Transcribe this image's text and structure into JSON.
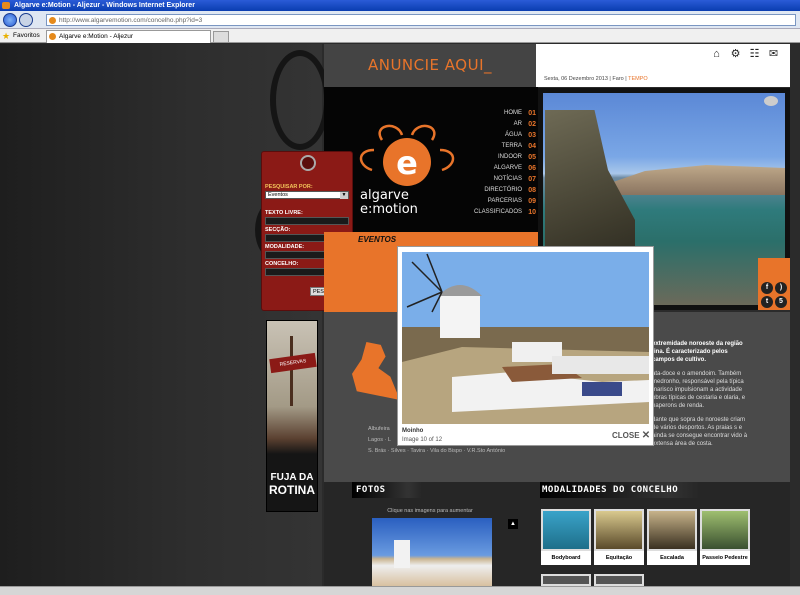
{
  "browser": {
    "title": "Algarve e:Motion - Aljezur - Windows Internet Explorer",
    "url": "http://www.algarvemotion.com/concelho.php?id=3",
    "favorites_label": "Favoritos",
    "tab_title": "Algarve e:Motion - Aljezur"
  },
  "ad": {
    "text": "ANUNCIE AQUI_"
  },
  "header": {
    "date": "Sexta, 06 Dezembro 2013",
    "location": "Faro",
    "weather_link": "TEMPO"
  },
  "logo": {
    "line1": "algarve",
    "line2": "e:motion"
  },
  "menu": [
    {
      "label": "HOME",
      "num": "01"
    },
    {
      "label": "AR",
      "num": "02"
    },
    {
      "label": "ÁGUA",
      "num": "03"
    },
    {
      "label": "TERRA",
      "num": "04"
    },
    {
      "label": "INDOOR",
      "num": "05"
    },
    {
      "label": "ALGARVE",
      "num": "06"
    },
    {
      "label": "NOTÍCIAS",
      "num": "07"
    },
    {
      "label": "DIRECTÓRIO",
      "num": "08"
    },
    {
      "label": "PARCERIAS",
      "num": "09"
    },
    {
      "label": "CLASSIFICADOS",
      "num": "10"
    }
  ],
  "search": {
    "heading": "PESQUISAR POR:",
    "type_value": "Eventos",
    "free_text_label": "TEXTO LIVRE:",
    "section_label": "SECÇÃO:",
    "modality_label": "MODALIDADE:",
    "council_label": "CONCELHO:",
    "button": "PESQUISAR"
  },
  "events_label": "EVENTOS",
  "banner": {
    "sign": "RESERVAS",
    "line1": "FUJA DA",
    "line2": "ROTINA"
  },
  "places": {
    "line1": "Albufeira",
    "line2": "Lagos · L",
    "line3": "S. Brás · Silves · Tavira · Vila do Bispo · V.R.Sto António"
  },
  "intro": {
    "p1": "extremidade noroeste da região",
    "p1b": "tina. É caracterizado pelos",
    "p1c": "campos de cultivo.",
    "p2": "ata-doce e o amendoim. Também medronho, responsável pela típica marisco impulsionam a actividade obras típicas de cestaria e olaria, e naperons de renda.",
    "p3": "dante que sopra de noroeste criam de vários desportos. As praias s e ainda se consegue encontrar vido à extensa área de costa."
  },
  "fotos": {
    "title": "FOTOS",
    "hint": "Clique nas imagens para aumentar"
  },
  "modalidades": {
    "title": "MODALIDADES DO CONCELHO",
    "items": [
      "Bodyboard",
      "Equitação",
      "Escalada",
      "Passeio Pedestre"
    ]
  },
  "lightbox": {
    "title": "Moinho",
    "counter": "Image 10 of 12",
    "close": "CLOSE"
  },
  "colors": {
    "accent": "#e8742a",
    "search_bg": "#8b1a16"
  }
}
